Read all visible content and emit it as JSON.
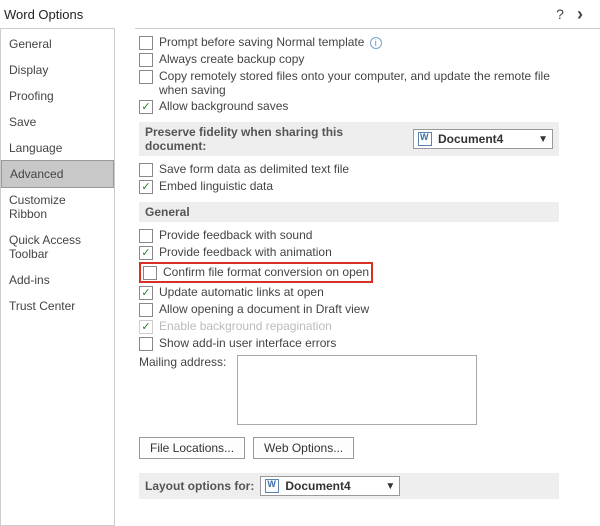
{
  "window": {
    "title": "Word Options",
    "help": "?",
    "close": "›"
  },
  "sidebar": {
    "items": [
      {
        "label": "General"
      },
      {
        "label": "Display"
      },
      {
        "label": "Proofing"
      },
      {
        "label": "Save"
      },
      {
        "label": "Language"
      },
      {
        "label": "Advanced",
        "selected": true
      },
      {
        "label": "Customize Ribbon"
      },
      {
        "label": "Quick Access Toolbar"
      },
      {
        "label": "Add-ins"
      },
      {
        "label": "Trust Center"
      }
    ]
  },
  "save_section": {
    "prompt_normal": "Prompt before saving Normal template",
    "backup_copy": "Always create backup copy",
    "copy_remote": "Copy remotely stored files onto your computer, and update the remote file when saving",
    "background_saves": "Allow background saves"
  },
  "fidelity": {
    "heading": "Preserve fidelity when sharing this document:",
    "doc": "Document4",
    "save_form_data": "Save form data as delimited text file",
    "embed_linguistic": "Embed linguistic data"
  },
  "general": {
    "heading": "General",
    "feedback_sound": "Provide feedback with sound",
    "feedback_animation": "Provide feedback with animation",
    "confirm_conversion": "Confirm file format conversion on open",
    "update_auto_links": "Update automatic links at open",
    "allow_draft": "Allow opening a document in Draft view",
    "background_repag": "Enable background repagination",
    "show_addin_errors": "Show add-in user interface errors",
    "mailing_label": "Mailing address:",
    "file_locations_btn": "File Locations...",
    "web_options_btn": "Web Options..."
  },
  "layout": {
    "heading": "Layout options for:",
    "doc": "Document4"
  }
}
